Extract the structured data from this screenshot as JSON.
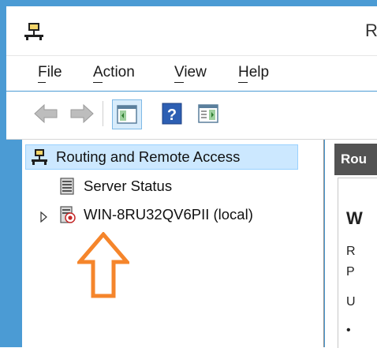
{
  "window": {
    "title_partial": "R"
  },
  "menu": {
    "items": [
      {
        "label": "File"
      },
      {
        "label": "Action"
      },
      {
        "label": "View"
      },
      {
        "label": "Help"
      }
    ]
  },
  "toolbar": {
    "icons": [
      "back-arrow-icon",
      "forward-arrow-icon",
      "show-hide-console-tree-icon",
      "help-icon",
      "show-hide-action-pane-icon"
    ]
  },
  "tree": {
    "root": {
      "label": "Routing and Remote Access",
      "icon": "routing-network-icon"
    },
    "children": [
      {
        "label": "Server Status",
        "icon": "server-status-icon"
      },
      {
        "label": "WIN-8RU32QV6PII (local)",
        "icon": "server-disabled-icon",
        "expandable": true
      }
    ]
  },
  "right_pane": {
    "header_partial": "Rou",
    "heading_partial": "W",
    "line1_partial": "R",
    "line2_partial": "P",
    "line3_partial": "U",
    "bullet": "•"
  },
  "annotation": {
    "arrow_color": "#f5852b",
    "points_to": "WIN-8RU32QV6PII (local)"
  },
  "colors": {
    "frame": "#4b9bd4",
    "selection_bg": "#cce8ff",
    "selection_border": "#99d1ff",
    "header_bg": "#535353"
  }
}
